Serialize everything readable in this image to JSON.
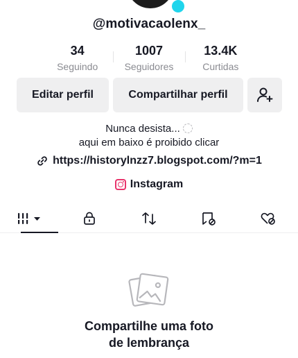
{
  "profile": {
    "username": "@motivacaolenx_",
    "bio_line1": "Nunca desista...",
    "bio_line2": "aqui em baixo é proibido clicar",
    "link": "https://historylnzz7.blogspot.com/?m=1",
    "instagram_label": "Instagram"
  },
  "stats": [
    {
      "value": "34",
      "label": "Seguindo"
    },
    {
      "value": "1007",
      "label": "Seguidores"
    },
    {
      "value": "13.4K",
      "label": "Curtidas"
    }
  ],
  "buttons": {
    "edit": "Editar perfil",
    "share": "Compartilhar perfil"
  },
  "tabs": [
    {
      "name": "videos",
      "icon": "grid-icon",
      "active": true
    },
    {
      "name": "private",
      "icon": "lock-icon"
    },
    {
      "name": "reposts",
      "icon": "repost-icon"
    },
    {
      "name": "favorites",
      "icon": "bookmark-icon"
    },
    {
      "name": "liked",
      "icon": "heart-hidden-icon"
    }
  ],
  "empty_state": {
    "title_line1": "Compartilhe uma foto",
    "title_line2": "de lembrança",
    "icon": "photo-icon"
  },
  "colors": {
    "accent_badge": "#20d5ec",
    "instagram": "#e8336b",
    "button_bg": "#efeff0"
  }
}
